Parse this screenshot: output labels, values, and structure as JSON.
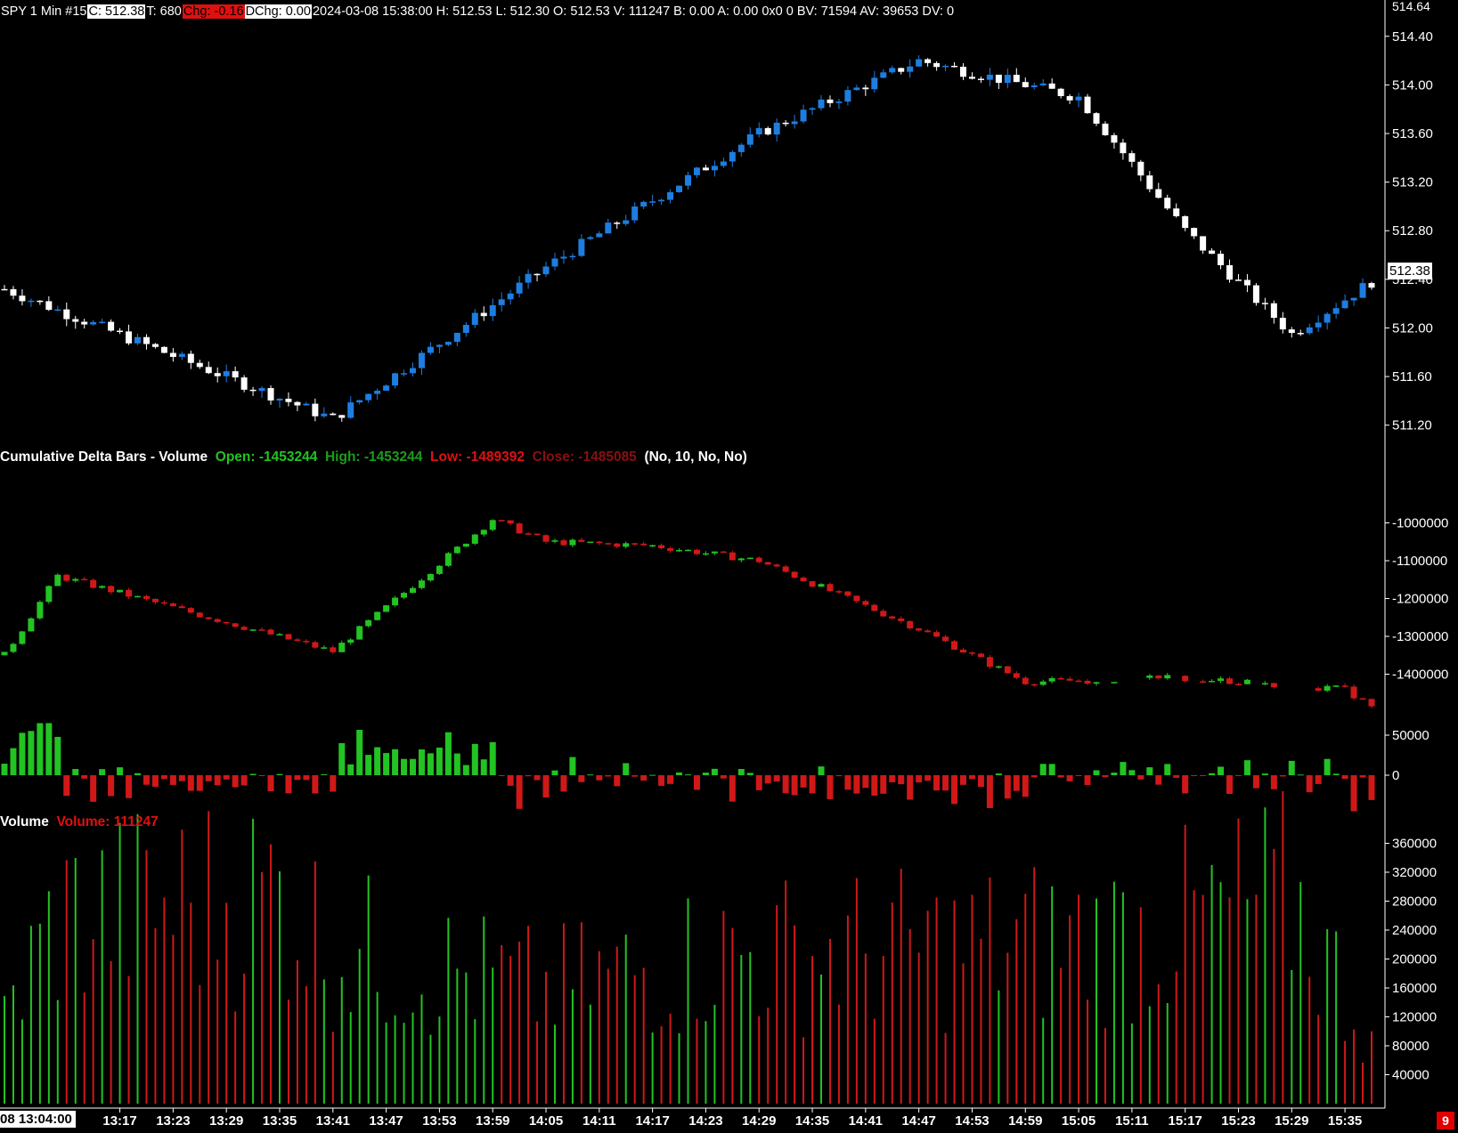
{
  "header": {
    "symbol": "SPY  1 Min  #15",
    "close": "C: 512.38",
    "trades": "T: 680",
    "chg": "Chg: -0.16",
    "dchg": "DChg: 0.00",
    "rest": "2024-03-08 15:38:00 H: 512.53 L: 512.30 O: 512.53 V: 111247 B: 0.00 A: 0.00 0x0 0 BV: 71594 AV: 39653 DV: 0"
  },
  "price_panel": {
    "top_label": "514.64",
    "last_price": "512.38",
    "ticks": [
      "514.40",
      "514.00",
      "513.60",
      "513.20",
      "512.80",
      "512.40",
      "512.00",
      "511.60",
      "511.20"
    ]
  },
  "cdelta_panel": {
    "name": "Cumulative Delta Bars - Volume",
    "open": "Open: -1453244",
    "high": "High: -1453244",
    "low": "Low: -1489392",
    "close": "Close: -1485085",
    "params": "(No, 10, No, No)",
    "ticks": [
      "-1000000",
      "-1100000",
      "-1200000",
      "-1300000",
      "-1400000"
    ]
  },
  "delta_panel": {
    "ticks": [
      "50000",
      "0"
    ]
  },
  "volume_panel": {
    "name": "Volume",
    "value": "Volume: 111247",
    "ticks": [
      "360000",
      "320000",
      "280000",
      "240000",
      "200000",
      "160000",
      "120000",
      "80000",
      "40000"
    ]
  },
  "time_axis": {
    "first": "08  13:04:00",
    "labels": [
      "13:17",
      "13:23",
      "13:29",
      "13:35",
      "13:41",
      "13:47",
      "13:53",
      "13:59",
      "14:05",
      "14:11",
      "14:17",
      "14:23",
      "14:29",
      "14:35",
      "14:41",
      "14:47",
      "14:53",
      "14:59",
      "15:05",
      "15:11",
      "15:17",
      "15:23",
      "15:29",
      "15:35"
    ]
  },
  "badge": "9",
  "colors": {
    "bg": "#000000",
    "up_candle": "#1e7de0",
    "down_candle": "#ffffff",
    "pos": "#22c322",
    "neg": "#d01818",
    "text": "#ffffff"
  },
  "chart_data": [
    {
      "type": "candlestick",
      "title": "SPY 1 Min",
      "ylim": [
        511.0,
        514.64
      ],
      "x": [
        "13:04",
        "13:41",
        "14:05",
        "14:29",
        "14:47",
        "15:05",
        "15:17",
        "15:29",
        "15:38"
      ],
      "close": [
        512.32,
        511.25,
        512.5,
        513.6,
        514.2,
        513.9,
        512.8,
        511.95,
        512.38
      ]
    },
    {
      "type": "candlestick",
      "title": "Cumulative Delta Bars - Volume",
      "ylim": [
        -1500000,
        -900000
      ],
      "x": [
        "13:04",
        "13:10",
        "13:41",
        "13:59",
        "14:05",
        "14:17",
        "14:29",
        "14:47",
        "14:59",
        "15:17",
        "15:35",
        "15:38"
      ],
      "close": [
        -1350000,
        -1140000,
        -1340000,
        -990000,
        -1050000,
        -1060000,
        -1100000,
        -1280000,
        -1420000,
        -1410000,
        -1440000,
        -1485085
      ]
    },
    {
      "type": "bar",
      "title": "Volume",
      "ylim": [
        0,
        400000
      ],
      "x": [
        "13:04",
        "13:10",
        "13:35",
        "13:41",
        "14:05",
        "14:23",
        "14:53",
        "15:11",
        "15:29",
        "15:38"
      ],
      "values": [
        150000,
        320000,
        365000,
        270000,
        195000,
        255000,
        270000,
        290000,
        355000,
        111247
      ]
    }
  ]
}
